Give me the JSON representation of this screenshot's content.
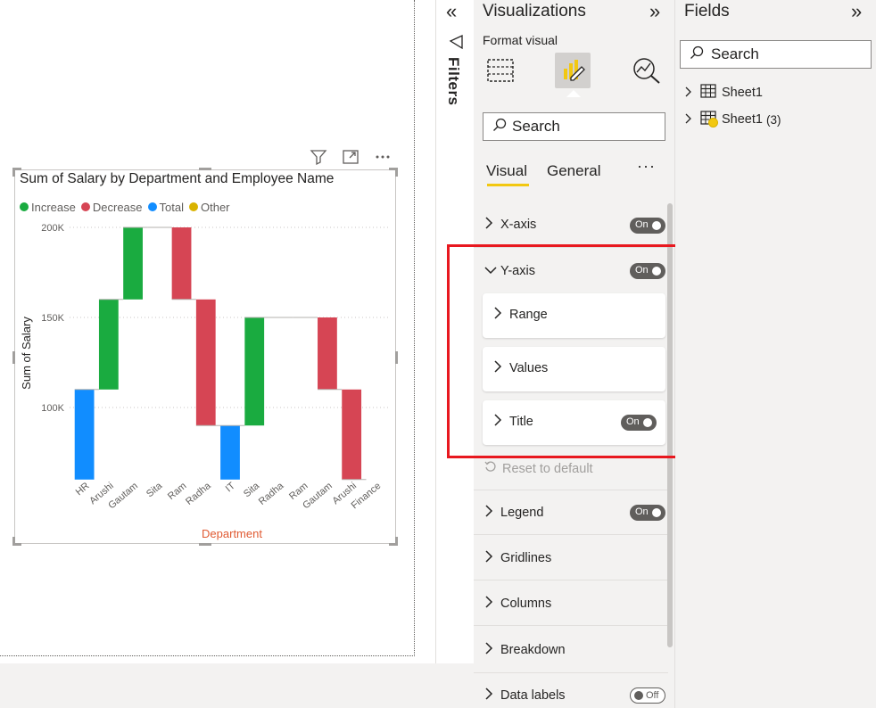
{
  "canvas": {
    "visual": {
      "title": "Sum of Salary by Department and Employee Name",
      "header_icons": [
        "filter-icon",
        "focus-mode-icon",
        "more-options-icon"
      ]
    }
  },
  "chart_data": {
    "type": "waterfall",
    "title": "Sum of Salary by Department and Employee Name",
    "xlabel": "Department",
    "ylabel": "Sum of Salary",
    "yticks": [
      "100K",
      "150K",
      "200K"
    ],
    "legend": [
      {
        "name": "Increase",
        "color": "#1aab40"
      },
      {
        "name": "Decrease",
        "color": "#d64554"
      },
      {
        "name": "Total",
        "color": "#118dff"
      },
      {
        "name": "Other",
        "color": "#d9b300"
      }
    ],
    "categories": [
      "HR",
      "Arushi",
      "Gautam",
      "Sita",
      "Ram",
      "Radha",
      "IT",
      "Sita",
      "Radha",
      "Ram",
      "Gautam",
      "Arushi",
      "Finance"
    ],
    "bars": [
      {
        "kind": "total",
        "start": 0,
        "end": 110000
      },
      {
        "kind": "increase",
        "start": 110000,
        "end": 160000
      },
      {
        "kind": "increase",
        "start": 160000,
        "end": 200000
      },
      {
        "kind": "flat",
        "start": 200000,
        "end": 200000
      },
      {
        "kind": "decrease",
        "start": 200000,
        "end": 160000
      },
      {
        "kind": "decrease",
        "start": 160000,
        "end": 90000
      },
      {
        "kind": "total",
        "start": 0,
        "end": 90000
      },
      {
        "kind": "increase",
        "start": 90000,
        "end": 150000
      },
      {
        "kind": "flat",
        "start": 150000,
        "end": 150000
      },
      {
        "kind": "flat",
        "start": 150000,
        "end": 150000
      },
      {
        "kind": "decrease",
        "start": 150000,
        "end": 110000
      },
      {
        "kind": "decrease",
        "start": 110000,
        "end": 60000
      },
      {
        "kind": "flat",
        "start": 60000,
        "end": 60000
      }
    ],
    "y_visible_range": [
      60000,
      200000
    ],
    "grid": true
  },
  "filters": {
    "label": "Filters"
  },
  "visualizations": {
    "title": "Visualizations",
    "format_label": "Format visual",
    "search_placeholder": "Search",
    "tabs": {
      "visual": "Visual",
      "general": "General",
      "more": "···"
    },
    "sections": {
      "x_axis": "X-axis",
      "y_axis": "Y-axis",
      "range": "Range",
      "values": "Values",
      "title": "Title",
      "reset": "Reset to default",
      "legend": "Legend",
      "gridlines": "Gridlines",
      "columns": "Columns",
      "breakdown": "Breakdown",
      "data_labels": "Data labels"
    },
    "toggles": {
      "on": "On",
      "off": "Off"
    }
  },
  "fields": {
    "title": "Fields",
    "search_placeholder": "Search",
    "tables": [
      {
        "name": "Sheet1",
        "suffix": ""
      },
      {
        "name": "Sheet1",
        "suffix": "(3)"
      }
    ]
  },
  "colors": {
    "accent": "#f2c811",
    "highlight": "#e8181f",
    "xlabel": "#e05a32"
  }
}
